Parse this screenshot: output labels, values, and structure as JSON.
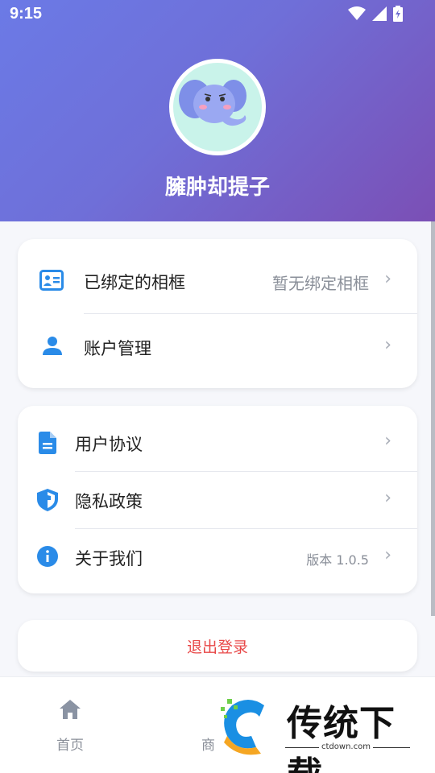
{
  "status_bar": {
    "time": "9:15",
    "icons": [
      "wifi-icon",
      "signal-icon",
      "battery-icon"
    ]
  },
  "profile": {
    "avatar_icon": "elephant-avatar",
    "username": "臃肿却提子"
  },
  "group1": {
    "rows": [
      {
        "icon": "id-card-icon",
        "label": "已绑定的相框",
        "value": "暂无绑定相框"
      },
      {
        "icon": "person-icon",
        "label": "账户管理",
        "value": ""
      }
    ]
  },
  "group2": {
    "rows": [
      {
        "icon": "document-icon",
        "label": "用户协议",
        "value": ""
      },
      {
        "icon": "shield-icon",
        "label": "隐私政策",
        "value": ""
      },
      {
        "icon": "info-icon",
        "label": "关于我们",
        "value": "版本 1.0.5"
      }
    ]
  },
  "logout": {
    "label": "退出登录"
  },
  "tabbar": {
    "tabs": [
      {
        "icon": "home-icon",
        "label": "首页"
      },
      {
        "icon": "",
        "label": "商"
      }
    ]
  },
  "watermark": {
    "text": "传统下载",
    "url": "ctdown.com"
  },
  "colors": {
    "header_start": "#6b7ae6",
    "header_end": "#7b4fb5",
    "accent": "#2a8be8",
    "danger": "#e84848"
  }
}
